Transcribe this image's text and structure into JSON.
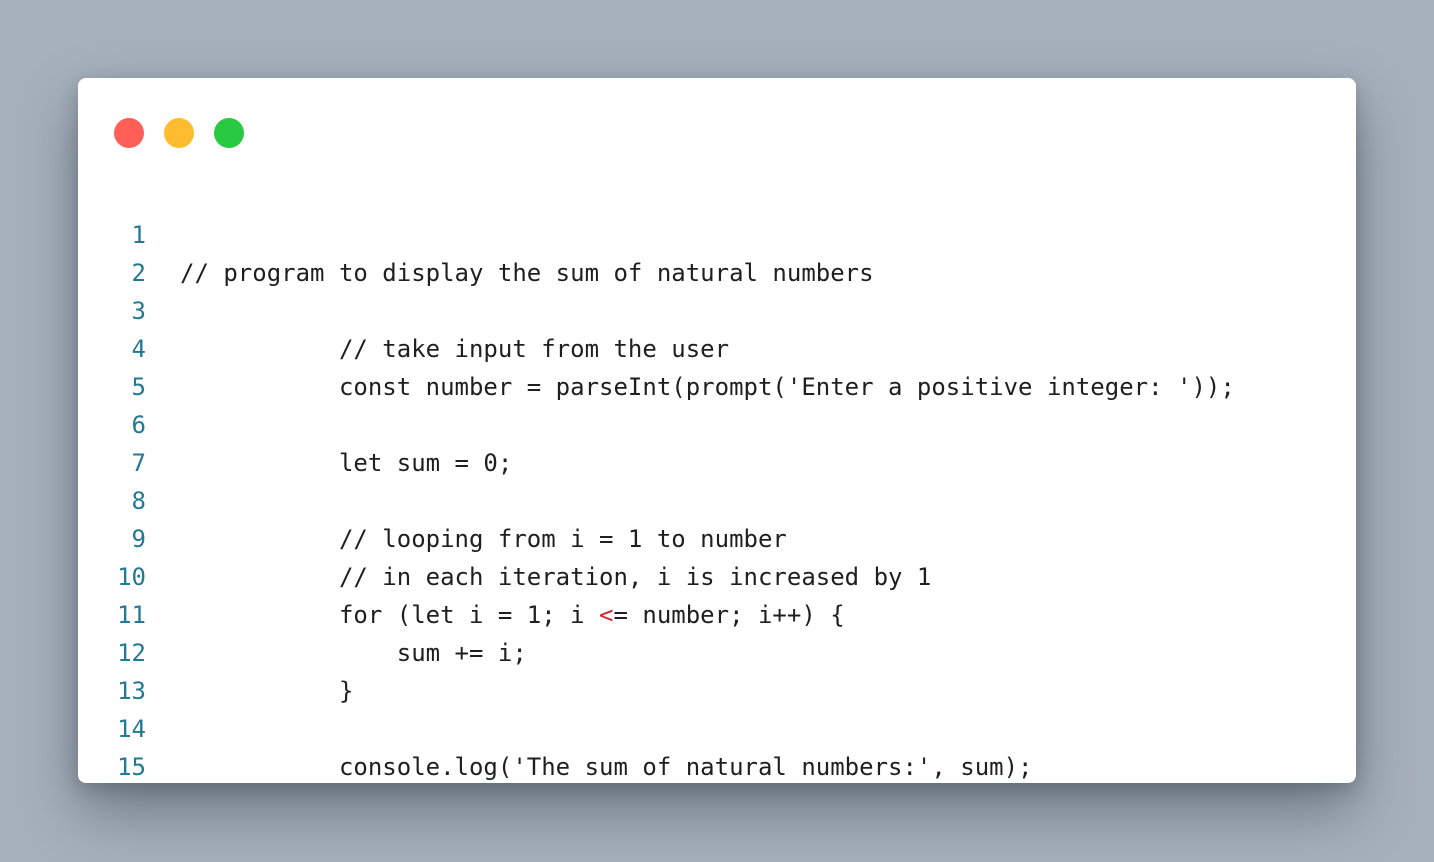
{
  "colors": {
    "background": "#a7b1bd",
    "window": "#ffffff",
    "close": "#ff5f57",
    "minimize": "#febc2e",
    "maximize": "#28c840",
    "line_number": "#237893",
    "code_text": "#1f1f1f",
    "operator_highlight": "#d1242f"
  },
  "window_controls": [
    {
      "name": "close-button",
      "icon": "red-circle-icon",
      "color": "#ff5f57"
    },
    {
      "name": "minimize-button",
      "icon": "yellow-circle-icon",
      "color": "#febc2e"
    },
    {
      "name": "maximize-button",
      "icon": "green-circle-icon",
      "color": "#28c840"
    }
  ],
  "code": {
    "lines": [
      {
        "number": "1",
        "text": "// program to display the sum of natural numbers"
      },
      {
        "number": "2",
        "text": ""
      },
      {
        "number": "3",
        "text": "           // take input from the user"
      },
      {
        "number": "4",
        "text": "           const number = parseInt(prompt('Enter a positive integer: '));"
      },
      {
        "number": "5",
        "text": ""
      },
      {
        "number": "6",
        "text": "           let sum = 0;"
      },
      {
        "number": "7",
        "text": ""
      },
      {
        "number": "8",
        "text": "           // looping from i = 1 to number"
      },
      {
        "number": "9",
        "text": "           // in each iteration, i is increased by 1"
      },
      {
        "number": "10",
        "text_before": "           for (let i = 1; i ",
        "operator": "<",
        "text_after": "= number; i++) {"
      },
      {
        "number": "11",
        "text": "               sum += i;"
      },
      {
        "number": "12",
        "text": "           }"
      },
      {
        "number": "13",
        "text": ""
      },
      {
        "number": "14",
        "text": "           console.log('The sum of natural numbers:', sum);"
      },
      {
        "number": "15",
        "text": ""
      }
    ]
  }
}
